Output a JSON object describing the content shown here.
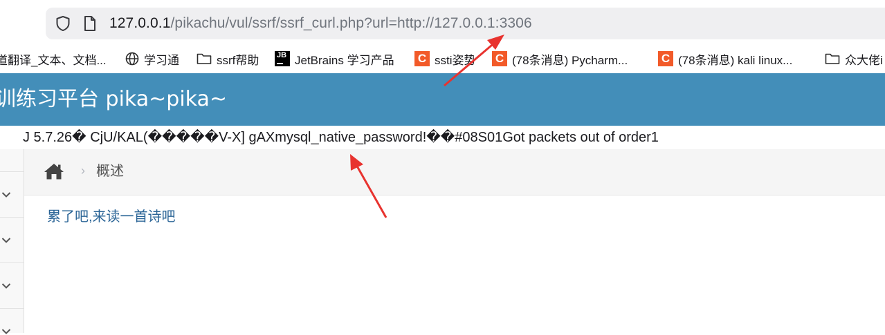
{
  "browser": {
    "url_host": "127.0.0.1",
    "url_rest": "/pikachu/vul/ssrf/ssrf_curl.php?url=http://127.0.0.1:3306",
    "icons": [
      "shield-icon",
      "page-icon"
    ]
  },
  "bookmarks": [
    {
      "label": "道翻译_文本、文档...",
      "icon": "none"
    },
    {
      "label": "学习通",
      "icon": "globe-icon"
    },
    {
      "label": "ssrf帮助",
      "icon": "folder-icon"
    },
    {
      "label": "JetBrains 学习产品",
      "icon": "jetbrains-icon"
    },
    {
      "label": "ssti姿势",
      "icon": "csdn-icon"
    },
    {
      "label": "(78条消息) Pycharm...",
      "icon": "csdn-icon"
    },
    {
      "label": "(78条消息) kali linux...",
      "icon": "csdn-icon"
    },
    {
      "label": "众大佬i",
      "icon": "folder-icon"
    }
  ],
  "header": {
    "title": "训练习平台 pika~pika~",
    "background": "#438eb9"
  },
  "response": {
    "leaked_text": "J 5.7.26� CjU/KAL(�����V-X] gAXmysql_native_password!��#08S01Got packets out of order1"
  },
  "breadcrumb": {
    "home_icon": "home-icon",
    "separator": "›",
    "label": "概述"
  },
  "content": {
    "link_text": "累了吧,来读一首诗吧",
    "link_color": "#2a6496"
  },
  "annotations": {
    "arrow_color": "#e8332f"
  }
}
